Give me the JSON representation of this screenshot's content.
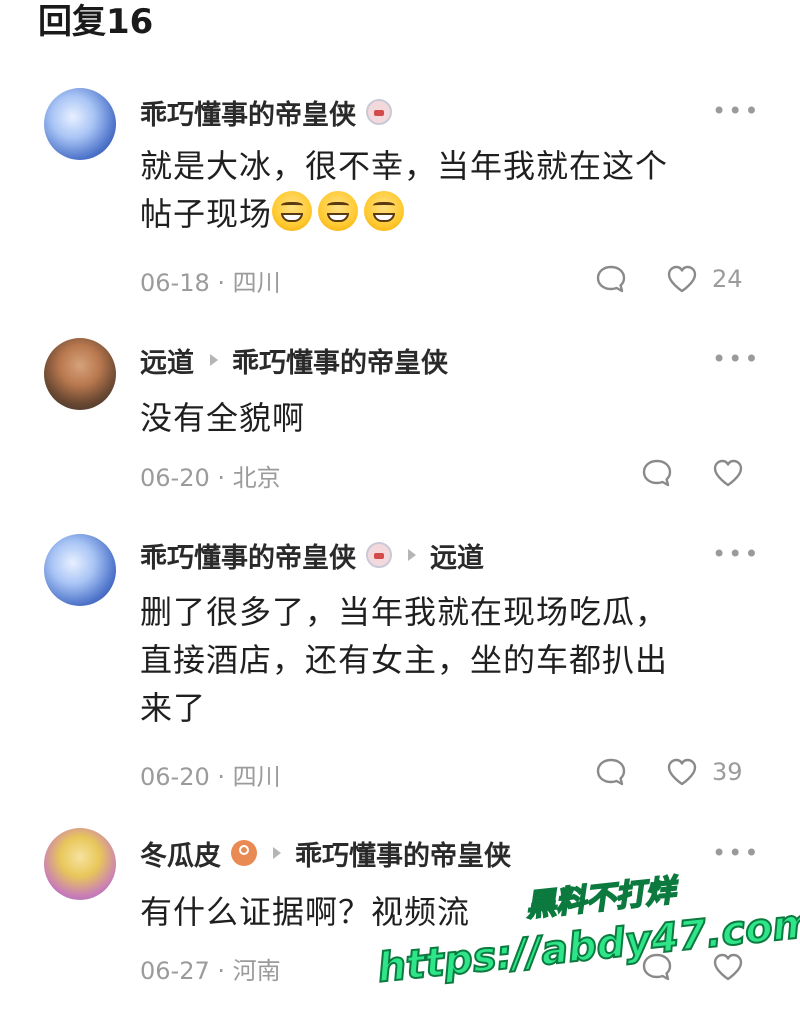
{
  "header": {
    "title": "回复16"
  },
  "comments": [
    {
      "author": "乖巧懂事的帝皇侠",
      "has_badge": true,
      "reply_to": "",
      "text_lines": [
        "就是大冰，很不幸，当年我就在这个",
        "帖子现场"
      ],
      "emoji_count": 3,
      "date": "06-18",
      "location": "四川",
      "likes": "24",
      "more": "•••"
    },
    {
      "author": "远道",
      "has_badge": false,
      "reply_to": "乖巧懂事的帝皇侠",
      "text_lines": [
        "没有全貌啊"
      ],
      "emoji_count": 0,
      "date": "06-20",
      "location": "北京",
      "likes": "",
      "more": "•••"
    },
    {
      "author": "乖巧懂事的帝皇侠",
      "has_badge": true,
      "reply_to": "远道",
      "text_lines": [
        "删了很多了，当年我就在现场吃瓜，",
        "直接酒店，还有女主，坐的车都扒出",
        "来了"
      ],
      "emoji_count": 0,
      "date": "06-20",
      "location": "四川",
      "likes": "39",
      "more": "•••"
    },
    {
      "author": "冬瓜皮",
      "has_badge": true,
      "reply_to": "乖巧懂事的帝皇侠",
      "text_lines": [
        "有什么证据啊？视频流"
      ],
      "emoji_count": 0,
      "date": "06-27",
      "location": "河南",
      "likes": "",
      "more": "•••"
    }
  ],
  "meta_separator": "·",
  "watermark": {
    "line1": "黑料不打烊",
    "line2": "https://abdy47.com"
  },
  "colors": {
    "meta": "#9b9b9b",
    "watermark": "#2ee58a"
  },
  "icons": {
    "reply": "speech-bubble-icon",
    "like": "heart-icon",
    "more": "ellipsis-icon"
  }
}
